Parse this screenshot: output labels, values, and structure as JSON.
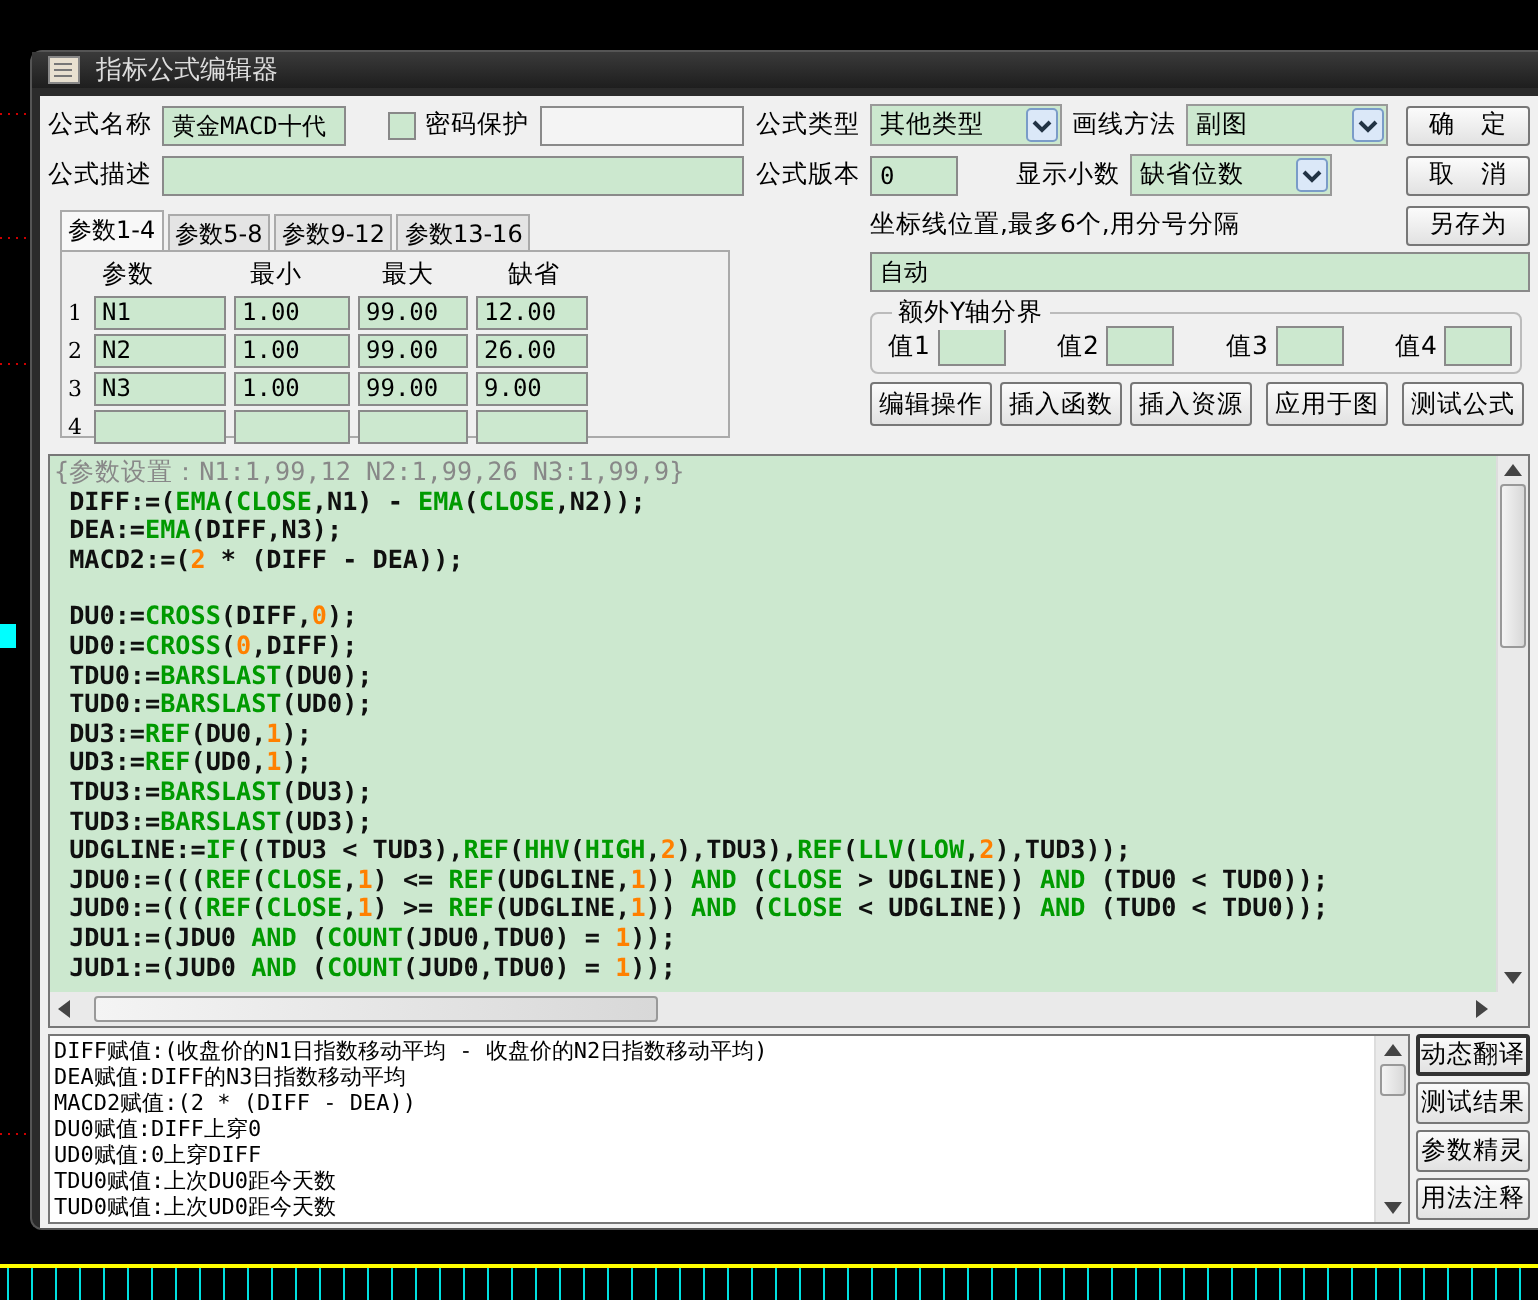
{
  "window": {
    "title": "指标公式编辑器"
  },
  "form": {
    "name_label": "公式名称",
    "name_value": "黄金MACD十代",
    "password": {
      "label": "密码保护",
      "checked": false
    },
    "desc_label": "公式描述",
    "type_label": "公式类型",
    "type_value": "其他类型",
    "draw_label": "画线方法",
    "draw_value": "副图",
    "version_label": "公式版本",
    "version_value": "0",
    "decimals_label": "显示小数",
    "decimals_value": "缺省位数"
  },
  "side_buttons": [
    "确　定",
    "取　消",
    "另存为"
  ],
  "tabs": [
    {
      "label": "参数1-4",
      "selected": true
    },
    {
      "label": "参数5-8",
      "selected": false
    },
    {
      "label": "参数9-12",
      "selected": false
    },
    {
      "label": "参数13-16",
      "selected": false
    }
  ],
  "params": {
    "columns": [
      "参数",
      "最小",
      "最大",
      "缺省"
    ],
    "rows": [
      {
        "index": "1",
        "cells": [
          "N1",
          "1.00",
          "99.00",
          "12.00"
        ]
      },
      {
        "index": "2",
        "cells": [
          "N2",
          "1.00",
          "99.00",
          "26.00"
        ]
      },
      {
        "index": "3",
        "cells": [
          "N3",
          "1.00",
          "99.00",
          "9.00"
        ]
      },
      {
        "index": "4",
        "cells": [
          "",
          "",
          "",
          ""
        ]
      }
    ]
  },
  "axis": {
    "label": "坐标线位置,最多6个,用分号分隔",
    "value": "自动",
    "group_label": "额外Y轴分界",
    "values": [
      {
        "label": "值1"
      },
      {
        "label": "值2"
      },
      {
        "label": "值3"
      },
      {
        "label": "值4"
      }
    ]
  },
  "tool_buttons": [
    "编辑操作",
    "插入函数",
    "插入资源",
    "应用于图",
    "测试公式"
  ],
  "code_blocks": [
    [
      [
        {
          "kind": "comment",
          "text": "{参数设置：N1:1,99,12 N2:1,99,26 N3:1,99,9}"
        }
      ],
      [
        {
          "kind": "plain",
          "text": " DIFF:=("
        },
        {
          "kind": "function",
          "text": "EMA"
        },
        {
          "kind": "plain",
          "text": "("
        },
        {
          "kind": "function",
          "text": "CLOSE"
        },
        {
          "kind": "plain",
          "text": ",N1) - "
        },
        {
          "kind": "function",
          "text": "EMA"
        },
        {
          "kind": "plain",
          "text": "("
        },
        {
          "kind": "function",
          "text": "CLOSE"
        },
        {
          "kind": "plain",
          "text": ",N2));"
        }
      ],
      [
        {
          "kind": "plain",
          "text": " DEA:="
        },
        {
          "kind": "function",
          "text": "EMA"
        },
        {
          "kind": "plain",
          "text": "(DIFF,N3);"
        }
      ],
      [
        {
          "kind": "plain",
          "text": " MACD2:=("
        },
        {
          "kind": "number",
          "text": "2"
        },
        {
          "kind": "plain",
          "text": " * (DIFF - DEA));"
        }
      ]
    ],
    [
      [
        {
          "kind": "plain",
          "text": " DU0:="
        },
        {
          "kind": "function",
          "text": "CROSS"
        },
        {
          "kind": "plain",
          "text": "(DIFF,"
        },
        {
          "kind": "number",
          "text": "0"
        },
        {
          "kind": "plain",
          "text": ");"
        }
      ],
      [
        {
          "kind": "plain",
          "text": " UD0:="
        },
        {
          "kind": "function",
          "text": "CROSS"
        },
        {
          "kind": "plain",
          "text": "("
        },
        {
          "kind": "number",
          "text": "0"
        },
        {
          "kind": "plain",
          "text": ",DIFF);"
        }
      ],
      [
        {
          "kind": "plain",
          "text": " TDU0:="
        },
        {
          "kind": "function",
          "text": "BARSLAST"
        },
        {
          "kind": "plain",
          "text": "(DU0);"
        }
      ],
      [
        {
          "kind": "plain",
          "text": " TUD0:="
        },
        {
          "kind": "function",
          "text": "BARSLAST"
        },
        {
          "kind": "plain",
          "text": "(UD0);"
        }
      ],
      [
        {
          "kind": "plain",
          "text": " DU3:="
        },
        {
          "kind": "function",
          "text": "REF"
        },
        {
          "kind": "plain",
          "text": "(DU0,"
        },
        {
          "kind": "number",
          "text": "1"
        },
        {
          "kind": "plain",
          "text": ");"
        }
      ],
      [
        {
          "kind": "plain",
          "text": " UD3:="
        },
        {
          "kind": "function",
          "text": "REF"
        },
        {
          "kind": "plain",
          "text": "(UD0,"
        },
        {
          "kind": "number",
          "text": "1"
        },
        {
          "kind": "plain",
          "text": ");"
        }
      ],
      [
        {
          "kind": "plain",
          "text": " TDU3:="
        },
        {
          "kind": "function",
          "text": "BARSLAST"
        },
        {
          "kind": "plain",
          "text": "(DU3);"
        }
      ],
      [
        {
          "kind": "plain",
          "text": " TUD3:="
        },
        {
          "kind": "function",
          "text": "BARSLAST"
        },
        {
          "kind": "plain",
          "text": "(UD3);"
        }
      ],
      [
        {
          "kind": "plain",
          "text": " UDGLINE:="
        },
        {
          "kind": "function",
          "text": "IF"
        },
        {
          "kind": "plain",
          "text": "((TDU3 < TUD3),"
        },
        {
          "kind": "function",
          "text": "REF"
        },
        {
          "kind": "plain",
          "text": "("
        },
        {
          "kind": "function",
          "text": "HHV"
        },
        {
          "kind": "plain",
          "text": "("
        },
        {
          "kind": "function",
          "text": "HIGH"
        },
        {
          "kind": "plain",
          "text": ","
        },
        {
          "kind": "number",
          "text": "2"
        },
        {
          "kind": "plain",
          "text": "),TDU3),"
        },
        {
          "kind": "function",
          "text": "REF"
        },
        {
          "kind": "plain",
          "text": "("
        },
        {
          "kind": "function",
          "text": "LLV"
        },
        {
          "kind": "plain",
          "text": "("
        },
        {
          "kind": "function",
          "text": "LOW"
        },
        {
          "kind": "plain",
          "text": ","
        },
        {
          "kind": "number",
          "text": "2"
        },
        {
          "kind": "plain",
          "text": "),TUD3));"
        }
      ],
      [
        {
          "kind": "plain",
          "text": " JDU0:=((("
        },
        {
          "kind": "function",
          "text": "REF"
        },
        {
          "kind": "plain",
          "text": "("
        },
        {
          "kind": "function",
          "text": "CLOSE"
        },
        {
          "kind": "plain",
          "text": ","
        },
        {
          "kind": "number",
          "text": "1"
        },
        {
          "kind": "plain",
          "text": ") <= "
        },
        {
          "kind": "function",
          "text": "REF"
        },
        {
          "kind": "plain",
          "text": "(UDGLINE,"
        },
        {
          "kind": "number",
          "text": "1"
        },
        {
          "kind": "plain",
          "text": ")) "
        },
        {
          "kind": "function",
          "text": "AND"
        },
        {
          "kind": "plain",
          "text": " ("
        },
        {
          "kind": "function",
          "text": "CLOSE"
        },
        {
          "kind": "plain",
          "text": " > UDGLINE)) "
        },
        {
          "kind": "function",
          "text": "AND"
        },
        {
          "kind": "plain",
          "text": " (TDU0 < TUD0));"
        }
      ],
      [
        {
          "kind": "plain",
          "text": " JUD0:=((("
        },
        {
          "kind": "function",
          "text": "REF"
        },
        {
          "kind": "plain",
          "text": "("
        },
        {
          "kind": "function",
          "text": "CLOSE"
        },
        {
          "kind": "plain",
          "text": ","
        },
        {
          "kind": "number",
          "text": "1"
        },
        {
          "kind": "plain",
          "text": ") >= "
        },
        {
          "kind": "function",
          "text": "REF"
        },
        {
          "kind": "plain",
          "text": "(UDGLINE,"
        },
        {
          "kind": "number",
          "text": "1"
        },
        {
          "kind": "plain",
          "text": ")) "
        },
        {
          "kind": "function",
          "text": "AND"
        },
        {
          "kind": "plain",
          "text": " ("
        },
        {
          "kind": "function",
          "text": "CLOSE"
        },
        {
          "kind": "plain",
          "text": " < UDGLINE)) "
        },
        {
          "kind": "function",
          "text": "AND"
        },
        {
          "kind": "plain",
          "text": " (TUD0 < TDU0));"
        }
      ],
      [
        {
          "kind": "plain",
          "text": " JDU1:=(JDU0 "
        },
        {
          "kind": "function",
          "text": "AND"
        },
        {
          "kind": "plain",
          "text": " ("
        },
        {
          "kind": "function",
          "text": "COUNT"
        },
        {
          "kind": "plain",
          "text": "(JDU0,TDU0) = "
        },
        {
          "kind": "number",
          "text": "1"
        },
        {
          "kind": "plain",
          "text": "));"
        }
      ],
      [
        {
          "kind": "plain",
          "text": " JUD1:=(JUD0 "
        },
        {
          "kind": "function",
          "text": "AND"
        },
        {
          "kind": "plain",
          "text": " ("
        },
        {
          "kind": "function",
          "text": "COUNT"
        },
        {
          "kind": "plain",
          "text": "(JUD0,TDU0) = "
        },
        {
          "kind": "number",
          "text": "1"
        },
        {
          "kind": "plain",
          "text": "));"
        }
      ]
    ]
  ],
  "output": [
    "DIFF赋值:(收盘价的N1日指数移动平均 - 收盘价的N2日指数移动平均)",
    "DEA赋值:DIFF的N3日指数移动平均",
    "MACD2赋值:(2 * (DIFF - DEA))",
    "DU0赋值:DIFF上穿0",
    "UD0赋值:0上穿DIFF",
    "TDU0赋值:上次DU0距今天数",
    "TUD0赋值:上次UD0距今天数"
  ],
  "output_buttons": [
    {
      "label": "动态翻译",
      "selected": true
    },
    {
      "label": "测试结果",
      "selected": false
    },
    {
      "label": "参数精灵",
      "selected": false
    },
    {
      "label": "用法注释",
      "selected": false
    }
  ]
}
